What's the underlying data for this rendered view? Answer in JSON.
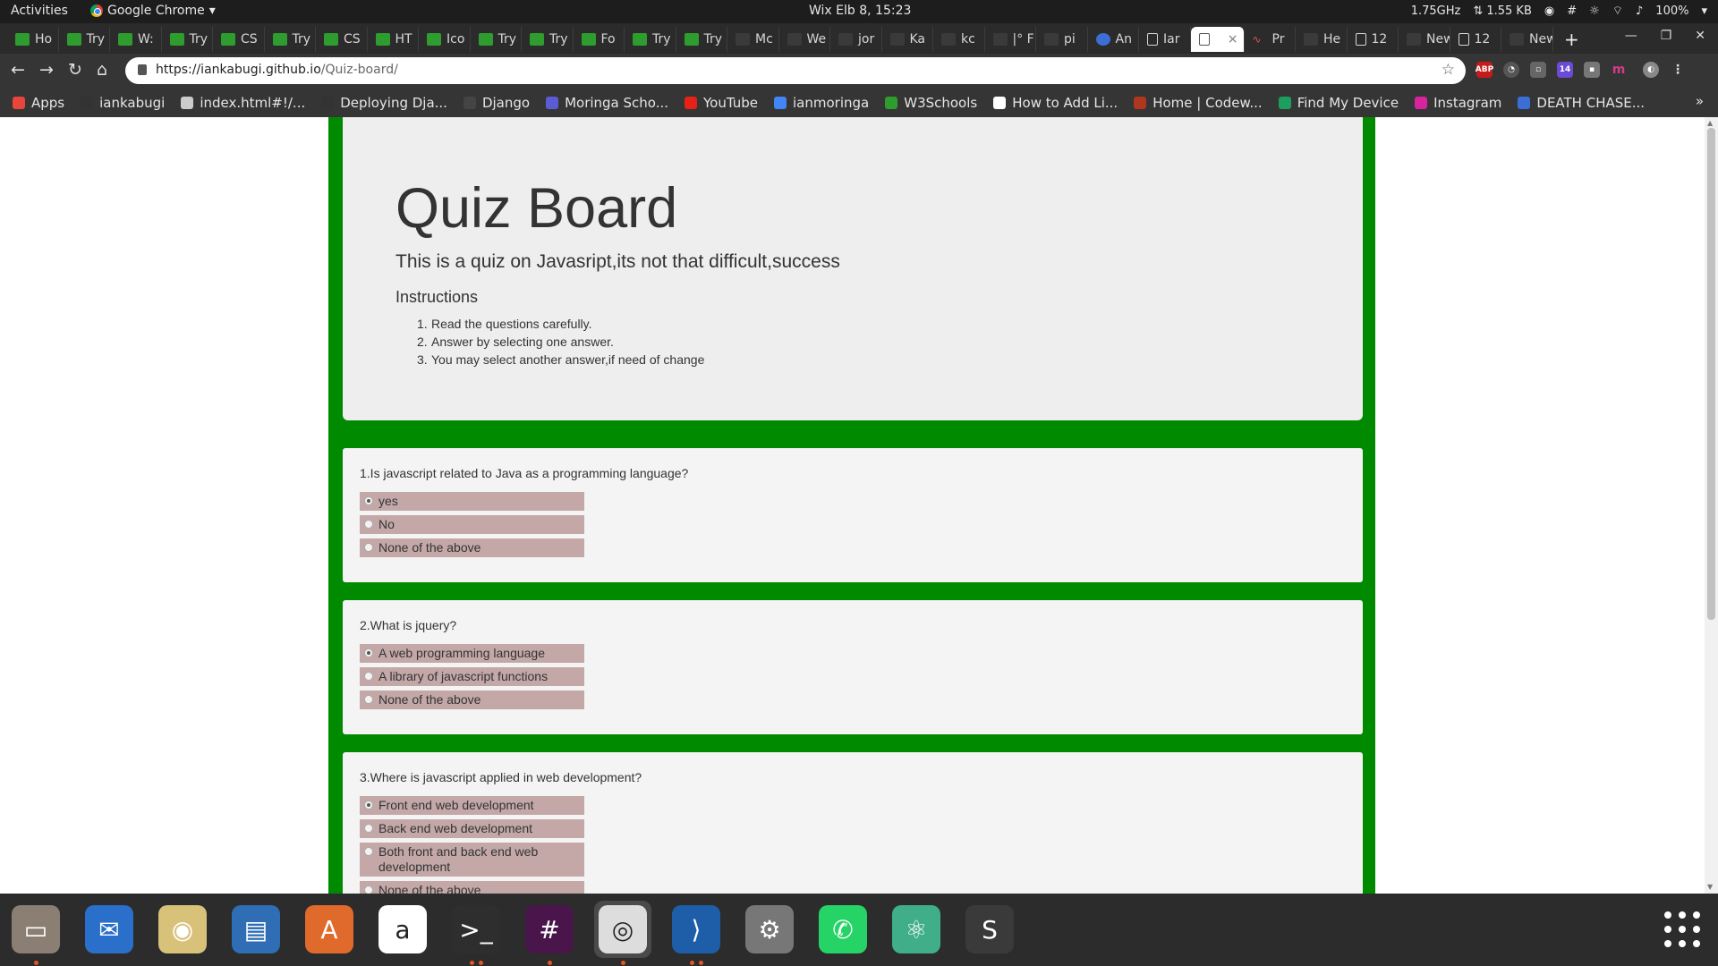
{
  "system_bar": {
    "activities": "Activities",
    "app_name": "Google Chrome",
    "clock": "Wix Elb  8, 15:23",
    "cpu": "1.75GHz",
    "net": "⇅ 1.55 KB",
    "battery": "100%"
  },
  "tabs": [
    {
      "label": "Ho",
      "icon": "green"
    },
    {
      "label": "Try",
      "icon": "green"
    },
    {
      "label": "W:",
      "icon": "green"
    },
    {
      "label": "Try",
      "icon": "green"
    },
    {
      "label": "CS",
      "icon": "green"
    },
    {
      "label": "Try",
      "icon": "green"
    },
    {
      "label": "CS",
      "icon": "green"
    },
    {
      "label": "HT",
      "icon": "green"
    },
    {
      "label": "Ico",
      "icon": "green"
    },
    {
      "label": "Try",
      "icon": "green"
    },
    {
      "label": "Try",
      "icon": "green"
    },
    {
      "label": "Fo",
      "icon": "green"
    },
    {
      "label": "Try",
      "icon": "green"
    },
    {
      "label": "Try",
      "icon": "green"
    },
    {
      "label": "Mc",
      "icon": "dark"
    },
    {
      "label": "We",
      "icon": "dark"
    },
    {
      "label": "jor",
      "icon": "dark"
    },
    {
      "label": "Ka",
      "icon": "dark"
    },
    {
      "label": "kc",
      "icon": "dark"
    },
    {
      "label": "|° F",
      "icon": "dark"
    },
    {
      "label": "pi",
      "icon": "dark"
    },
    {
      "label": "An",
      "icon": "blue"
    },
    {
      "label": "Iar",
      "icon": "doc"
    }
  ],
  "active_tab": {
    "close": "×"
  },
  "tabs_right": [
    {
      "label": "Pr",
      "icon": "red"
    },
    {
      "label": "He",
      "icon": "dark"
    },
    {
      "label": "12",
      "icon": "doc"
    },
    {
      "label": "New T",
      "icon": "dark"
    },
    {
      "label": "12",
      "icon": "doc"
    },
    {
      "label": "New T",
      "icon": "dark"
    }
  ],
  "toolbar": {
    "url_host": "https://iankabugi.github.io",
    "url_path": "/Quiz-board/"
  },
  "bookmarks": [
    {
      "label": "Apps",
      "color": "#e8453c"
    },
    {
      "label": "iankabugi",
      "color": "#333333"
    },
    {
      "label": "index.html#!/...",
      "color": "#cccccc"
    },
    {
      "label": "Deploying Dja...",
      "color": "#333333"
    },
    {
      "label": "Django",
      "color": "#444444"
    },
    {
      "label": "Moringa Scho...",
      "color": "#5b5bd6"
    },
    {
      "label": "YouTube",
      "color": "#e62117"
    },
    {
      "label": "ianmoringa",
      "color": "#4285f4"
    },
    {
      "label": "W3Schools",
      "color": "#2e9c2e"
    },
    {
      "label": "How to Add Li...",
      "color": "#ffffff"
    },
    {
      "label": "Home | Codew...",
      "color": "#b1361e"
    },
    {
      "label": "Find My Device",
      "color": "#1e9e5e"
    },
    {
      "label": "Instagram",
      "color": "#d6249f"
    },
    {
      "label": "DEATH CHASE...",
      "color": "#3b6fd6"
    }
  ],
  "page": {
    "title": "Quiz Board",
    "lead": "This is a quiz on Javasript,its not that difficult,success",
    "instructions_heading": "Instructions",
    "instructions": [
      "Read the questions carefully.",
      "Answer by selecting one answer.",
      "You may select another answer,if need of change"
    ],
    "questions": [
      {
        "text": "1.Is javascript related to Java as a programming language?",
        "options": [
          "yes",
          "No",
          "None of the above"
        ],
        "selected": 0
      },
      {
        "text": "2.What is jquery?",
        "options": [
          "A web programming language",
          "A library of javascript functions",
          "None of the above"
        ],
        "selected": 0
      },
      {
        "text": "3.Where is javascript applied in web development?",
        "options": [
          "Front end web development",
          "Back end web development",
          "Both front and back end web development",
          "None of the above"
        ],
        "selected": 0
      }
    ]
  },
  "dock": [
    {
      "name": "files",
      "color": "#8a7f72",
      "glyph": "▭"
    },
    {
      "name": "thunderbird",
      "color": "#2a6fc9",
      "glyph": "✉"
    },
    {
      "name": "rhythmbox",
      "color": "#d8c27a",
      "glyph": "◉"
    },
    {
      "name": "writer",
      "color": "#2f6db5",
      "glyph": "▤"
    },
    {
      "name": "software",
      "color": "#e06a2b",
      "glyph": "A"
    },
    {
      "name": "amazon",
      "color": "#ffffff",
      "glyph": "a"
    },
    {
      "name": "terminal",
      "color": "#2e2e2e",
      "glyph": ">_"
    },
    {
      "name": "slack",
      "color": "#4a154b",
      "glyph": "#"
    },
    {
      "name": "chrome",
      "color": "#dddddd",
      "glyph": "◎"
    },
    {
      "name": "vscode",
      "color": "#1e5ea8",
      "glyph": "⟩"
    },
    {
      "name": "settings",
      "color": "#777777",
      "glyph": "⚙"
    },
    {
      "name": "whatsapp",
      "color": "#25d366",
      "glyph": "✆"
    },
    {
      "name": "atom",
      "color": "#3fae89",
      "glyph": "⚛"
    },
    {
      "name": "sublime",
      "color": "#3a3a3a",
      "glyph": "S"
    }
  ]
}
